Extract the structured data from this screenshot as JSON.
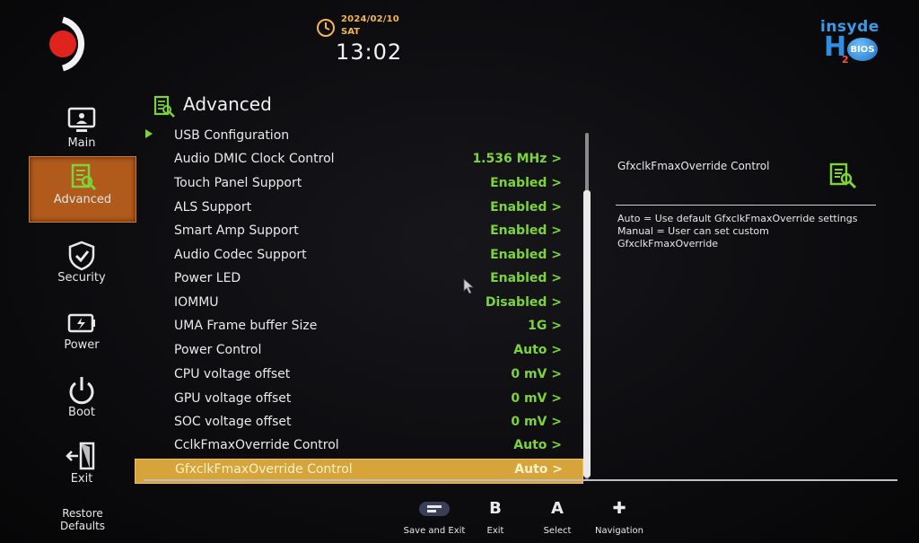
{
  "header": {
    "date": "2024/02/10",
    "day": "SAT",
    "time": "13:02",
    "brand_top": "insyde",
    "brand_h": "H",
    "brand_sub": "2",
    "brand_bios": "BIOS"
  },
  "sidebar": {
    "items": [
      {
        "label": "Main",
        "icon": "monitor-icon",
        "active": false
      },
      {
        "label": "Advanced",
        "icon": "advanced-icon",
        "active": true
      },
      {
        "label": "Security",
        "icon": "shield-icon",
        "active": false
      },
      {
        "label": "Power",
        "icon": "battery-icon",
        "active": false
      },
      {
        "label": "Boot",
        "icon": "power-icon",
        "active": false
      },
      {
        "label": "Exit",
        "icon": "exit-door-icon",
        "active": false
      }
    ],
    "restore_line1": "Restore",
    "restore_line2": "Defaults"
  },
  "section": {
    "title": "Advanced"
  },
  "settings": [
    {
      "name": "USB Configuration",
      "value": "",
      "submenu": true
    },
    {
      "name": "Audio DMIC Clock Control",
      "value": "1.536 MHz >"
    },
    {
      "name": "Touch Panel Support",
      "value": "Enabled >"
    },
    {
      "name": "ALS Support",
      "value": "Enabled >"
    },
    {
      "name": "Smart Amp Support",
      "value": "Enabled >"
    },
    {
      "name": "Audio Codec Support",
      "value": "Enabled >"
    },
    {
      "name": "Power LED",
      "value": "Enabled >"
    },
    {
      "name": "IOMMU",
      "value": "Disabled >"
    },
    {
      "name": "UMA Frame buffer Size",
      "value": "1G >"
    },
    {
      "name": "Power Control",
      "value": "Auto >"
    },
    {
      "name": "CPU voltage offset",
      "value": "0 mV >"
    },
    {
      "name": "GPU voltage offset",
      "value": "0 mV >"
    },
    {
      "name": "SOC voltage offset",
      "value": "0 mV >"
    },
    {
      "name": "CclkFmaxOverride Control",
      "value": "Auto >"
    },
    {
      "name": "GfxclkFmaxOverride Control",
      "value": "Auto >",
      "selected": true
    }
  ],
  "help": {
    "title": "GfxclkFmaxOverride Control",
    "line1": "Auto = Use default GfxclkFmaxOverride settings",
    "line2": "Manual = User can set custom",
    "line3": "GfxclkFmaxOverride"
  },
  "footer": {
    "hints": [
      {
        "key": "",
        "label": "Save and Exit",
        "icon": "controller-menu-icon"
      },
      {
        "key": "B",
        "label": "Exit"
      },
      {
        "key": "A",
        "label": "Select"
      },
      {
        "key": "✚",
        "label": "Navigation",
        "icon": "dpad-icon"
      }
    ]
  },
  "colors": {
    "accent_green": "#7cd33a",
    "active_tab": "#b05a1c",
    "selected_row": "#d6a43a",
    "clock_amber": "#f2b64a"
  }
}
